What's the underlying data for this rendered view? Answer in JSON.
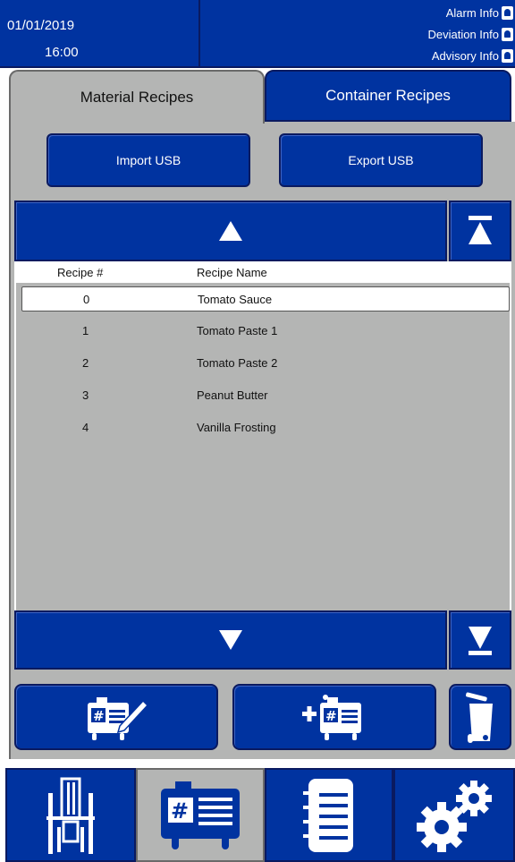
{
  "header": {
    "date": "01/01/2019",
    "time": "16:00",
    "alarm_info": "Alarm Info",
    "deviation_info": "Deviation Info",
    "advisory_info": "Advisory Info"
  },
  "tabs": [
    {
      "label": "Material Recipes",
      "active": true
    },
    {
      "label": "Container Recipes",
      "active": false
    }
  ],
  "toolbar": {
    "import_label": "Import USB",
    "export_label": "Export USB"
  },
  "table": {
    "columns": [
      "Recipe #",
      "Recipe Name"
    ],
    "rows": [
      {
        "num": "0",
        "name": "Tomato Sauce",
        "selected": true
      },
      {
        "num": "1",
        "name": "Tomato Paste 1",
        "selected": false
      },
      {
        "num": "2",
        "name": "Tomato Paste 2",
        "selected": false
      },
      {
        "num": "3",
        "name": "Peanut Butter",
        "selected": false
      },
      {
        "num": "4",
        "name": "Vanilla Frosting",
        "selected": false
      }
    ]
  },
  "icons": {
    "scroll_up": "triangle-up-icon",
    "scroll_top": "scroll-to-top-icon",
    "scroll_down": "triangle-down-icon",
    "scroll_bottom": "scroll-to-bottom-icon",
    "edit": "edit-recipe-icon",
    "add": "add-recipe-icon",
    "delete": "trash-icon",
    "nav": [
      "machine-icon",
      "recipe-container-icon",
      "notebook-icon",
      "gears-icon"
    ]
  },
  "colors": {
    "accent": "#0033a0",
    "panel": "#b4b5b4",
    "text_on_accent": "#ffffff"
  }
}
